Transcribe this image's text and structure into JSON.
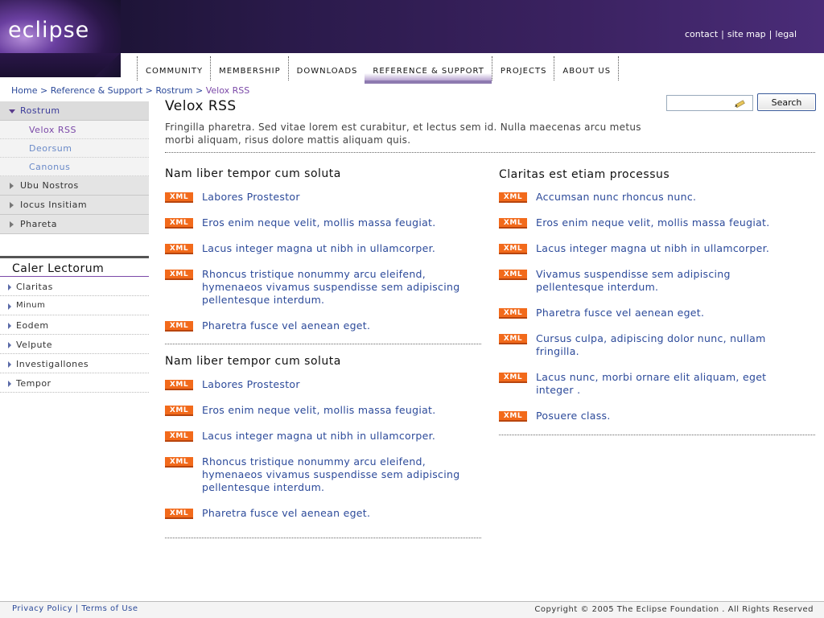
{
  "header": {
    "logo_text": "eclipse",
    "top_links": [
      "contact",
      "site map",
      "legal"
    ],
    "nav_tabs": [
      "COMMUNITY",
      "MEMBERSHIP",
      "DOWNLOADS",
      "REFERENCE & SUPPORT",
      "PROJECTS",
      "ABOUT US"
    ],
    "active_tab": "REFERENCE & SUPPORT"
  },
  "breadcrumb": {
    "items": [
      "Home",
      "Reference & Support",
      "Rostrum"
    ],
    "separator": ">",
    "current": "Velox RSS"
  },
  "sidebar": {
    "items": [
      {
        "label": "Rostrum",
        "expanded": true,
        "children": [
          "Velox RSS",
          "Deorsum",
          "Canonus"
        ]
      },
      {
        "label": "Ubu Nostros"
      },
      {
        "label": "Iocus Insitiam"
      },
      {
        "label": "Phareta"
      }
    ]
  },
  "reader": {
    "title": "Caler Lectorum",
    "items": [
      "Claritas",
      "Minum",
      "Eodem",
      "Velpute",
      "Investigallones",
      "Tempor"
    ]
  },
  "search": {
    "button_label": "Search",
    "value": ""
  },
  "main": {
    "title": "Velox RSS",
    "intro": "Fringilla pharetra. Sed vitae lorem est curabitur, et lectus sem id. Nulla maecenas arcu metus morbi aliquam, risus dolore mattis aliquam quis.",
    "badge_label": "XML",
    "left_sections": [
      {
        "title": "Nam liber tempor cum soluta",
        "items": [
          "Labores Prostestor",
          "Eros enim neque velit, mollis massa feugiat.",
          "Lacus integer magna ut nibh in ullamcorper.",
          "Rhoncus tristique nonummy arcu eleifend, hymenaeos vivamus suspendisse sem adipiscing pellentesque interdum.",
          "Pharetra fusce vel aenean eget."
        ]
      },
      {
        "title": "Nam liber tempor cum soluta",
        "items": [
          "Labores Prostestor",
          "Eros enim neque velit, mollis massa feugiat.",
          "Lacus integer magna ut nibh in ullamcorper.",
          "Rhoncus tristique nonummy arcu eleifend, hymenaeos vivamus suspendisse sem adipiscing pellentesque interdum.",
          "Pharetra fusce vel aenean eget."
        ]
      }
    ],
    "right_section": {
      "title": "Claritas est etiam processus",
      "items": [
        "Accumsan nunc rhoncus nunc.",
        "Eros enim neque velit, mollis massa feugiat.",
        "Lacus integer magna ut nibh in ullamcorper.",
        "Vivamus suspendisse sem adipiscing pellentesque interdum.",
        "Pharetra fusce vel aenean eget.",
        "Cursus culpa, adipiscing dolor nunc, nullam fringilla.",
        "Lacus nunc, morbi ornare elit aliquam, eget integer .",
        "Posuere class."
      ]
    }
  },
  "footer": {
    "links": [
      "Privacy Policy",
      "Terms of Use"
    ],
    "copyright": "Copyright © 2005  The Eclipse Foundation . All Rights Reserved"
  },
  "colors": {
    "banner": "#2a1a4a",
    "link": "#2c4a9a",
    "accent": "#7b49a8",
    "xml_badge": "#f26a1b"
  }
}
